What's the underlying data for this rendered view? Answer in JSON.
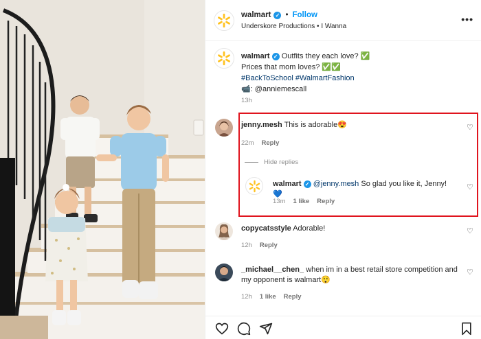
{
  "post": {
    "account": "walmart",
    "follow_label": "Follow",
    "audio": "Underskore Productions • I Wanna",
    "more_label": "•••",
    "caption": {
      "line1": "Outfits they each love? ✅",
      "line2": "Prices that mom loves? ✅✅",
      "hashtags": "#BackToSchool #WalmartFashion",
      "credit": "📹: @anniemescall"
    },
    "time": "13h"
  },
  "comments": [
    {
      "username": "jenny.mesh",
      "text": "This is adorable😍",
      "time": "22m",
      "reply_label": "Reply",
      "hide_replies_label": "Hide replies",
      "reply": {
        "username": "walmart",
        "mention": "@jenny.mesh",
        "text": "So glad you like it, Jenny! 💙",
        "time": "13m",
        "likes": "1 like",
        "reply_label": "Reply"
      }
    },
    {
      "username": "copycatsstyle",
      "text": "Adorable!",
      "time": "12h",
      "reply_label": "Reply"
    },
    {
      "username": "_michael__chen_",
      "text": "when im in a best retail store competition and my opponent is walmart😲",
      "time": "12h",
      "likes": "1 like",
      "reply_label": "Reply"
    }
  ],
  "colors": {
    "accent": "#0095f6",
    "verified": "#1c96e8",
    "highlight": "#e0141e",
    "walmart_spark": "#ffc220"
  },
  "icons": [
    "heart-icon",
    "comment-icon",
    "share-icon",
    "bookmark-icon",
    "verified-badge-icon",
    "more-icon",
    "camera-icon"
  ]
}
